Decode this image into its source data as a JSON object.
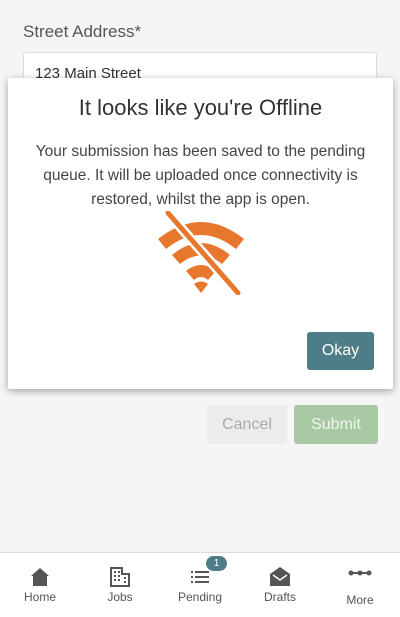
{
  "form": {
    "street_label": "Street Address*",
    "street_value": "123 Main Street",
    "cancel_label": "Cancel",
    "submit_label": "Submit"
  },
  "modal": {
    "title": "It looks like you're Offline",
    "body": "Your submission has been saved to the pending queue. It will be uploaded once connectivity is restored, whilst the app is open.",
    "icon": "wifi-off-icon",
    "icon_color": "#e8772e",
    "okay_label": "Okay"
  },
  "nav": {
    "items": [
      {
        "label": "Home",
        "icon": "home-icon"
      },
      {
        "label": "Jobs",
        "icon": "building-icon"
      },
      {
        "label": "Pending",
        "icon": "list-icon",
        "badge": "1"
      },
      {
        "label": "Drafts",
        "icon": "envelope-open-icon"
      },
      {
        "label": "More",
        "icon": "more-dots-icon"
      }
    ]
  },
  "colors": {
    "accent": "#4f7d87",
    "submit_disabled": "#a9c9a5",
    "warning": "#e8772e"
  }
}
